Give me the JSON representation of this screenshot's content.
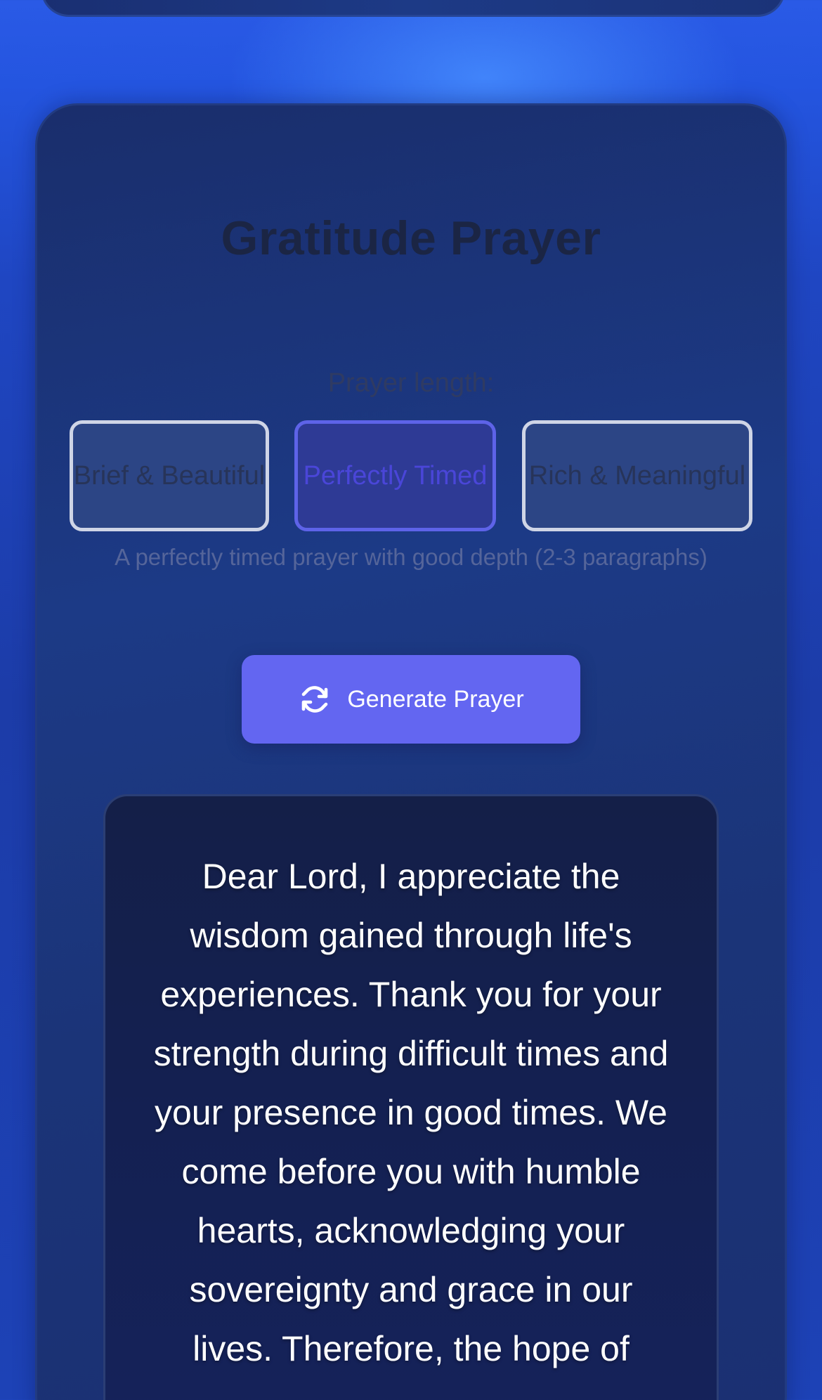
{
  "card": {
    "title": "Gratitude Prayer"
  },
  "length": {
    "label": "Prayer length:",
    "options": [
      {
        "label": "Brief & Beautiful",
        "selected": false
      },
      {
        "label": "Perfectly Timed",
        "selected": true
      },
      {
        "label": "Rich & Meaningful",
        "selected": false
      }
    ],
    "description": "A perfectly timed prayer with good depth (2-3 paragraphs)"
  },
  "actions": {
    "generate_label": "Generate Prayer",
    "generate_icon": "refresh-icon"
  },
  "prayer": {
    "text": "Dear Lord, I appreciate the wisdom gained through life's experiences. Thank you for your strength during difficult times and your presence in good times. We come before you with humble hearts, acknowledging your sovereignty and grace in our lives. Therefore, the hope of"
  },
  "colors": {
    "accent": "#6366f1",
    "background": "#1f46c2",
    "card": "#1c3a86",
    "prayer_box": "#142050"
  }
}
